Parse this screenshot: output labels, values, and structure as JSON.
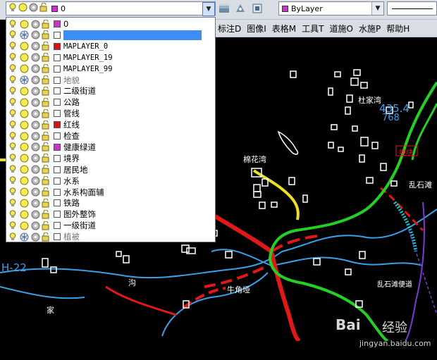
{
  "toolbar": {
    "layer_combo_value": "0",
    "linetype_combo_value": "ByLayer"
  },
  "menubar": {
    "items": [
      "标注D",
      "图像I",
      "表格M",
      "工具T",
      "道施O",
      "水施P",
      "帮助H"
    ]
  },
  "layers": [
    {
      "name": "0",
      "color": "#cc33cc",
      "frozen": false,
      "mono": false
    },
    {
      "name": "",
      "color": "#ffffff",
      "frozen": true,
      "mono": false,
      "selected": true
    },
    {
      "name": "MAPLAYER_0",
      "color": "#dd1111",
      "frozen": false,
      "mono": true
    },
    {
      "name": "MAPLAYER_19",
      "color": "#ffffff",
      "frozen": false,
      "mono": true
    },
    {
      "name": "MAPLAYER_99",
      "color": "#ffffff",
      "frozen": false,
      "mono": true
    },
    {
      "name": "地貌",
      "color": "#ffffff",
      "frozen": true,
      "mono": false
    },
    {
      "name": "二级街道",
      "color": "#ffffff",
      "frozen": false,
      "mono": false
    },
    {
      "name": "公路",
      "color": "#ffffff",
      "frozen": false,
      "mono": false
    },
    {
      "name": "管线",
      "color": "#ffffff",
      "frozen": false,
      "mono": false
    },
    {
      "name": "红线",
      "color": "#dd1111",
      "frozen": false,
      "mono": false
    },
    {
      "name": "检查",
      "color": "#ffffff",
      "frozen": false,
      "mono": false
    },
    {
      "name": "健康绿道",
      "color": "#cc33cc",
      "frozen": false,
      "mono": false
    },
    {
      "name": "境界",
      "color": "#ffffff",
      "frozen": false,
      "mono": false
    },
    {
      "name": "居民地",
      "color": "#ffffff",
      "frozen": false,
      "mono": false
    },
    {
      "name": "水系",
      "color": "#ffffff",
      "frozen": false,
      "mono": false
    },
    {
      "name": "水系构面辅",
      "color": "#ffffff",
      "frozen": false,
      "mono": false
    },
    {
      "name": "铁路",
      "color": "#ffffff",
      "frozen": false,
      "mono": false
    },
    {
      "name": "图外整饰",
      "color": "#ffffff",
      "frozen": false,
      "mono": false
    },
    {
      "name": "一级街道",
      "color": "#ffffff",
      "frozen": false,
      "mono": false
    },
    {
      "name": "植被",
      "color": "#ffffff",
      "frozen": true,
      "mono": false
    }
  ],
  "map_labels": {
    "dujiawan": "杜家湾",
    "elevation": "435.4",
    "elevation2": "768",
    "mianhuawan": "棉花湾",
    "luanshitan": "乱石滩",
    "niujiaoya": "牛角垭",
    "luanshitan_road": "乱石滩便道",
    "gou": "沟",
    "jia": "家",
    "roadcode": "H-22",
    "redtag": "地块"
  },
  "watermark": {
    "brand": "Bai",
    "brand2": "经验",
    "site": "jingyan.baidu.com"
  }
}
